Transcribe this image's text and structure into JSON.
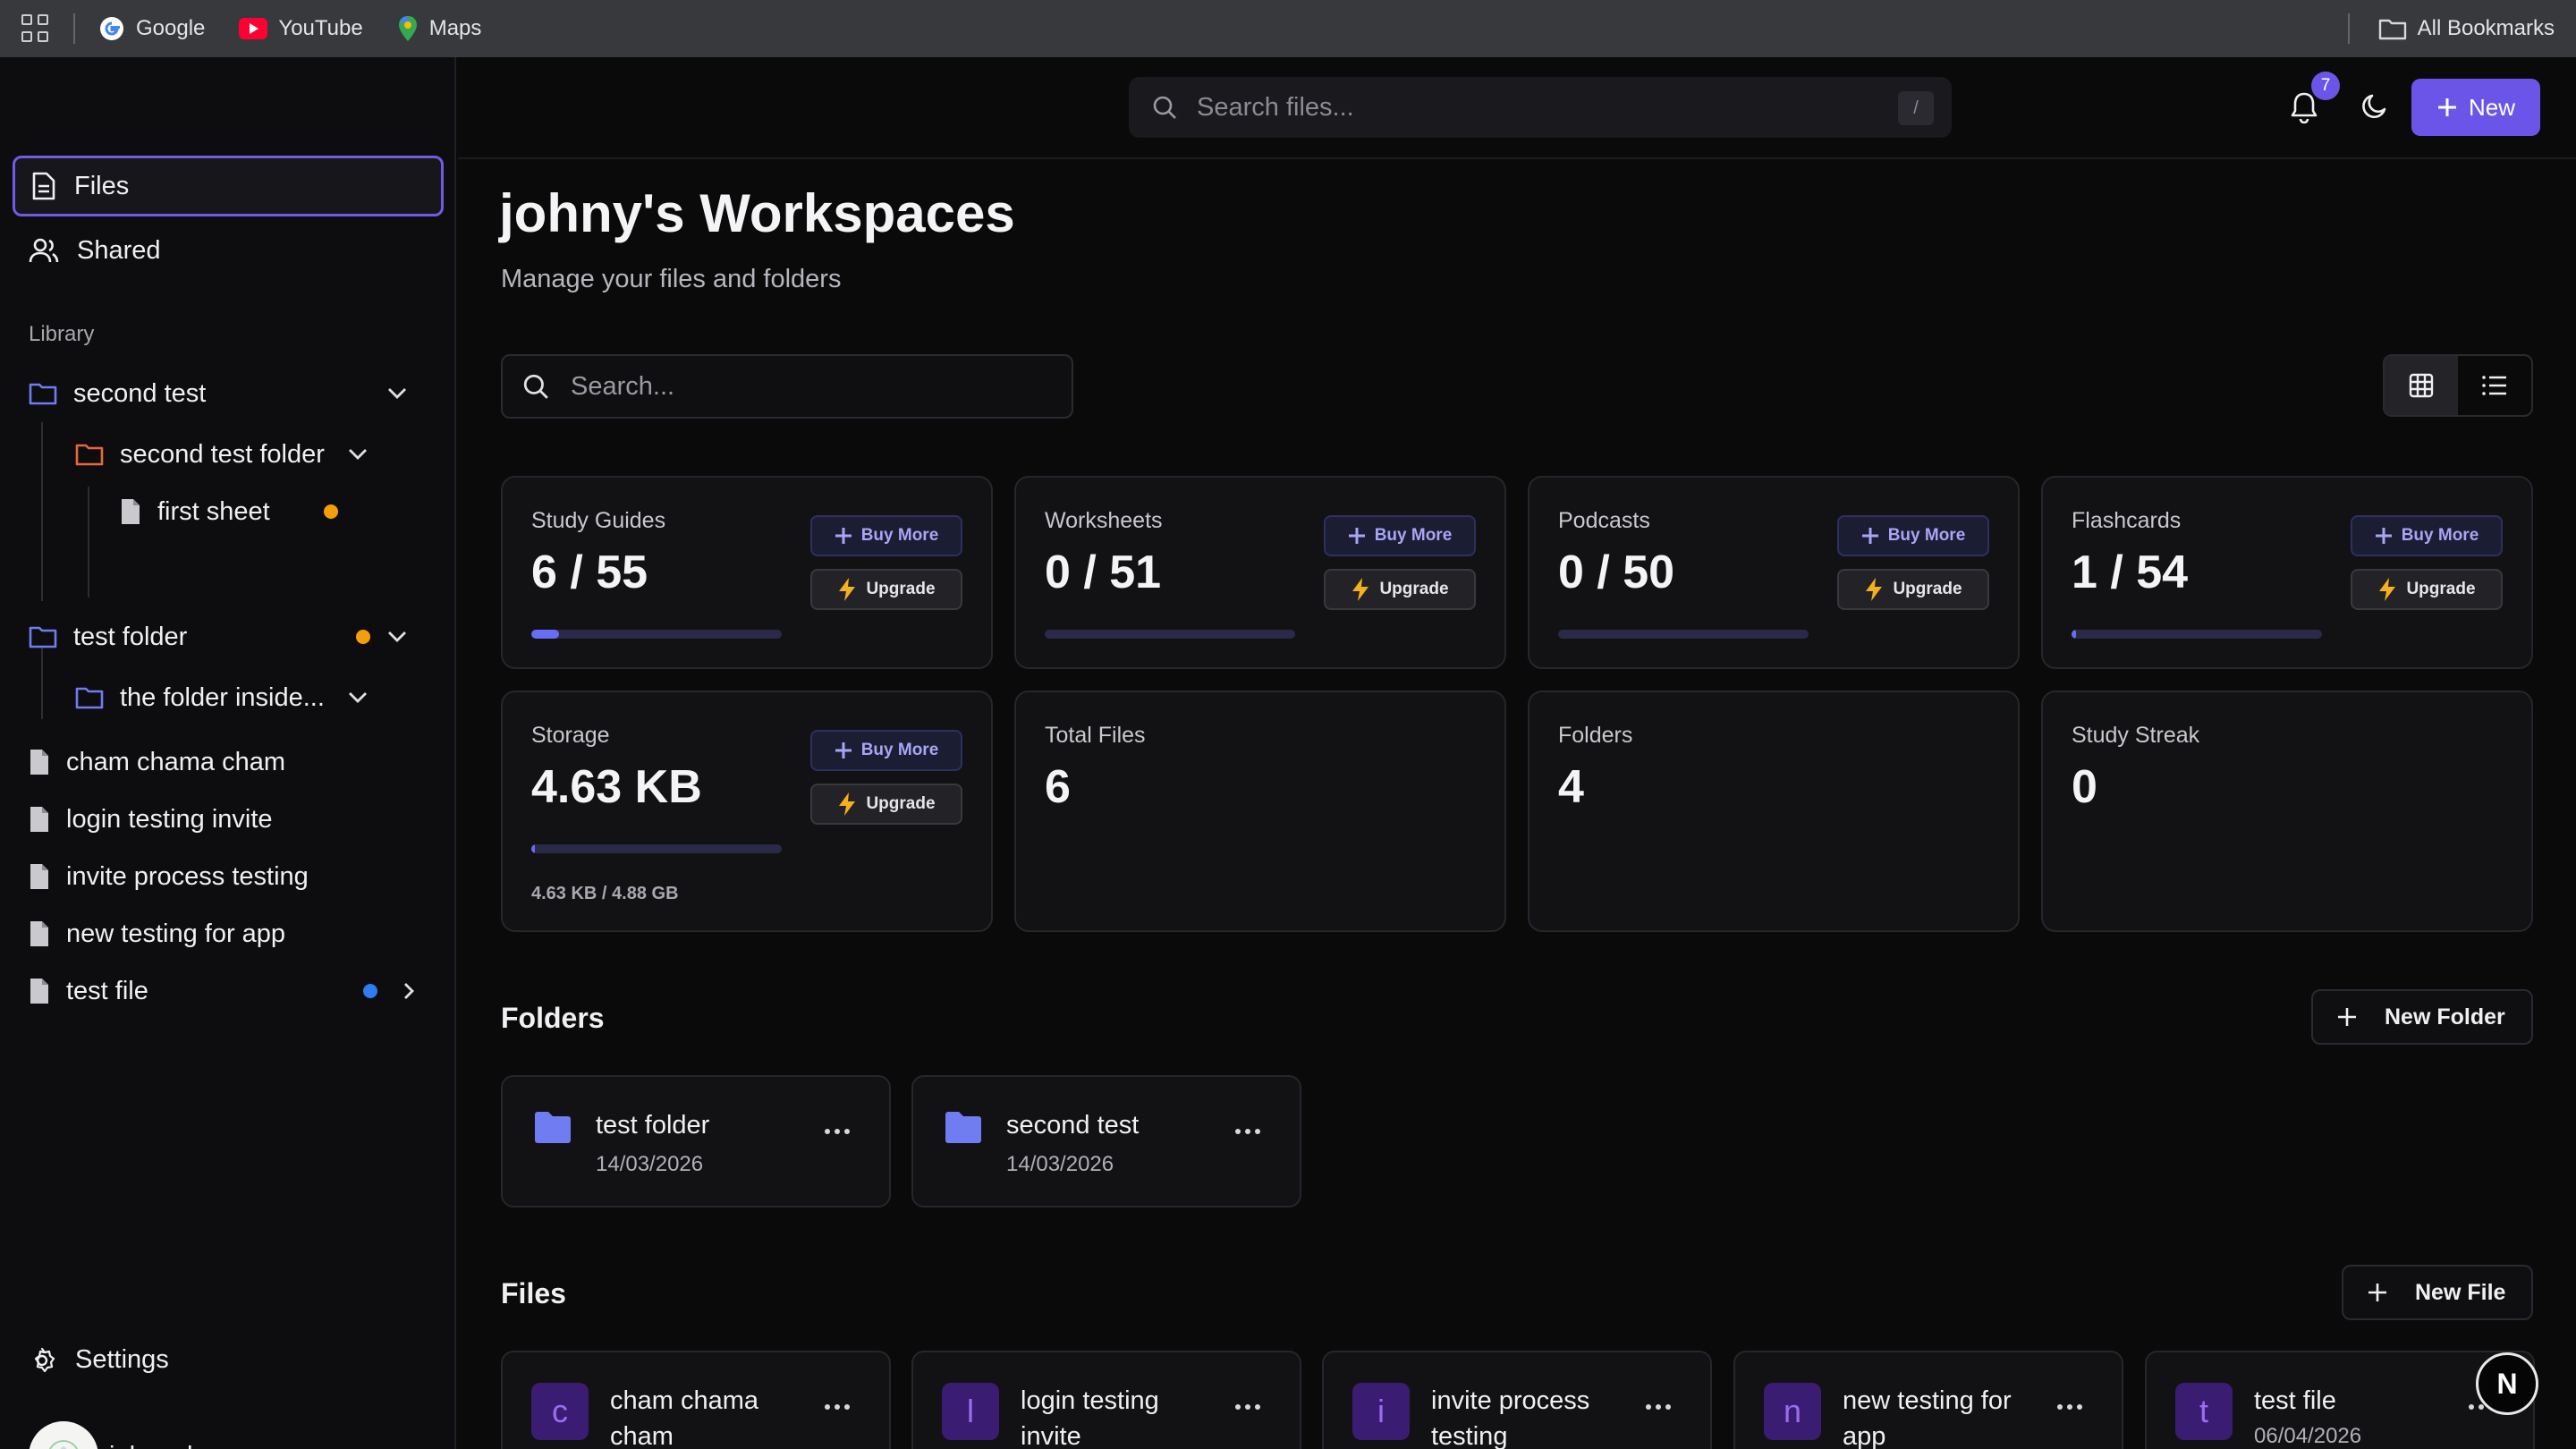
{
  "bookmarks": {
    "items": [
      {
        "label": "Google",
        "icon": "google-icon"
      },
      {
        "label": "YouTube",
        "icon": "youtube-icon"
      },
      {
        "label": "Maps",
        "icon": "maps-icon"
      }
    ],
    "all_bookmarks": "All Bookmarks"
  },
  "sidebar": {
    "nav": [
      {
        "label": "Files",
        "icon": "file-icon",
        "active": true
      },
      {
        "label": "Shared",
        "icon": "users-icon",
        "active": false
      }
    ],
    "library_label": "Library",
    "tree": [
      {
        "label": "second test",
        "type": "folder",
        "color": "#6f7cf2"
      },
      {
        "label": "second test folder",
        "type": "folder",
        "color": "#e8673c"
      },
      {
        "label": "first sheet",
        "type": "file",
        "dot": "#f59e0b"
      },
      {
        "label": "test folder",
        "type": "folder",
        "color": "#6f7cf2",
        "dot": "#f59e0b"
      },
      {
        "label": "the folder inside...",
        "type": "folder",
        "color": "#6f7cf2"
      },
      {
        "label": "cham chama cham",
        "type": "file"
      },
      {
        "label": "login testing invite",
        "type": "file"
      },
      {
        "label": "invite process testing",
        "type": "file"
      },
      {
        "label": "new testing for app",
        "type": "file"
      },
      {
        "label": "test file",
        "type": "file",
        "dot": "#2f7bf0"
      }
    ],
    "settings_label": "Settings",
    "user_name": "johny depps"
  },
  "header": {
    "search_placeholder": "Search files...",
    "shortcut": "/",
    "notification_count": "7",
    "new_label": "New"
  },
  "main": {
    "title": "johny's Workspaces",
    "subtitle": "Manage your files and folders",
    "search_placeholder": "Search...",
    "stats": [
      {
        "label": "Study Guides",
        "value": "6 / 55",
        "progress": 0.109,
        "buy": "Buy More",
        "upgrade": "Upgrade"
      },
      {
        "label": "Worksheets",
        "value": "0 / 51",
        "progress": 0,
        "buy": "Buy More",
        "upgrade": "Upgrade"
      },
      {
        "label": "Podcasts",
        "value": "0 / 50",
        "progress": 0,
        "buy": "Buy More",
        "upgrade": "Upgrade"
      },
      {
        "label": "Flashcards",
        "value": "1 / 54",
        "progress": 0.0185,
        "buy": "Buy More",
        "upgrade": "Upgrade"
      },
      {
        "label": "Storage",
        "value": "4.63 KB",
        "progress": 1e-06,
        "note": "4.63 KB / 4.88 GB",
        "buy": "Buy More",
        "upgrade": "Upgrade"
      },
      {
        "label": "Total Files",
        "value": "6"
      },
      {
        "label": "Folders",
        "value": "4"
      },
      {
        "label": "Study Streak",
        "value": "0"
      }
    ],
    "folders_title": "Folders",
    "new_folder_label": "New Folder",
    "folders": [
      {
        "name": "test folder",
        "date": "14/03/2026"
      },
      {
        "name": "second test",
        "date": "14/03/2026"
      }
    ],
    "files_title": "Files",
    "new_file_label": "New File",
    "files": [
      {
        "letter": "c",
        "name": "cham chama cham",
        "date": ""
      },
      {
        "letter": "l",
        "name": "login testing invite",
        "date": ""
      },
      {
        "letter": "i",
        "name": "invite process testing",
        "date": ""
      },
      {
        "letter": "n",
        "name": "new testing for app",
        "date": ""
      },
      {
        "letter": "t",
        "name": "test file",
        "date": "06/04/2026"
      }
    ],
    "fab_label": "N"
  },
  "colors": {
    "accent": "#6b55e8",
    "background": "#0a0a0b",
    "card": "#121215",
    "progress_fill": "#6a6cf5"
  }
}
